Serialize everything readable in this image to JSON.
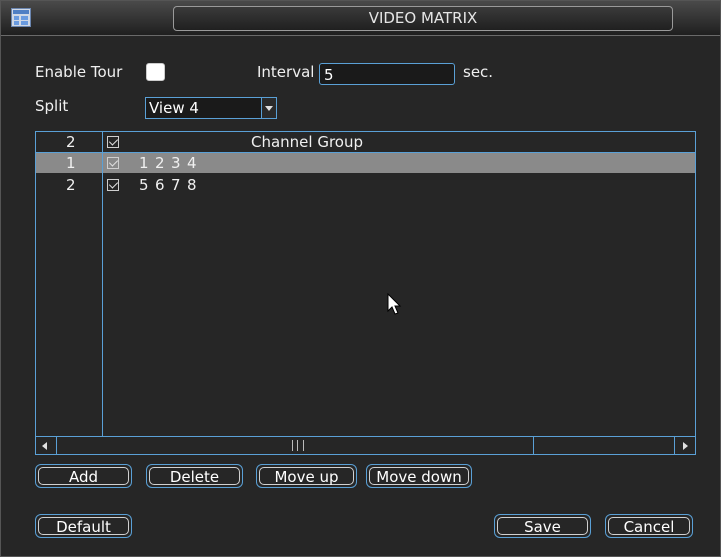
{
  "window": {
    "title": "VIDEO MATRIX"
  },
  "tour": {
    "enable_label": "Enable Tour",
    "interval_label": "Interval",
    "interval_value": "5",
    "unit": "sec."
  },
  "split": {
    "label": "Split",
    "value": "View 4"
  },
  "table": {
    "header": {
      "count": "2",
      "column_title": "Channel Group"
    },
    "rows": [
      {
        "index": "1",
        "channels": [
          "1",
          "2",
          "3",
          "4"
        ],
        "selected": true
      },
      {
        "index": "2",
        "channels": [
          "5",
          "6",
          "7",
          "8"
        ],
        "selected": false
      }
    ]
  },
  "buttons": {
    "add": "Add",
    "delete": "Delete",
    "move_up": "Move up",
    "move_down": "Move down",
    "default": "Default",
    "save": "Save",
    "cancel": "Cancel"
  },
  "colors": {
    "accent": "#5aa0d6",
    "selected_row": "#8a8a8a",
    "background": "#262626"
  },
  "icons": {
    "app": "window-grid-icon",
    "cursor": "mouse-pointer-icon"
  }
}
